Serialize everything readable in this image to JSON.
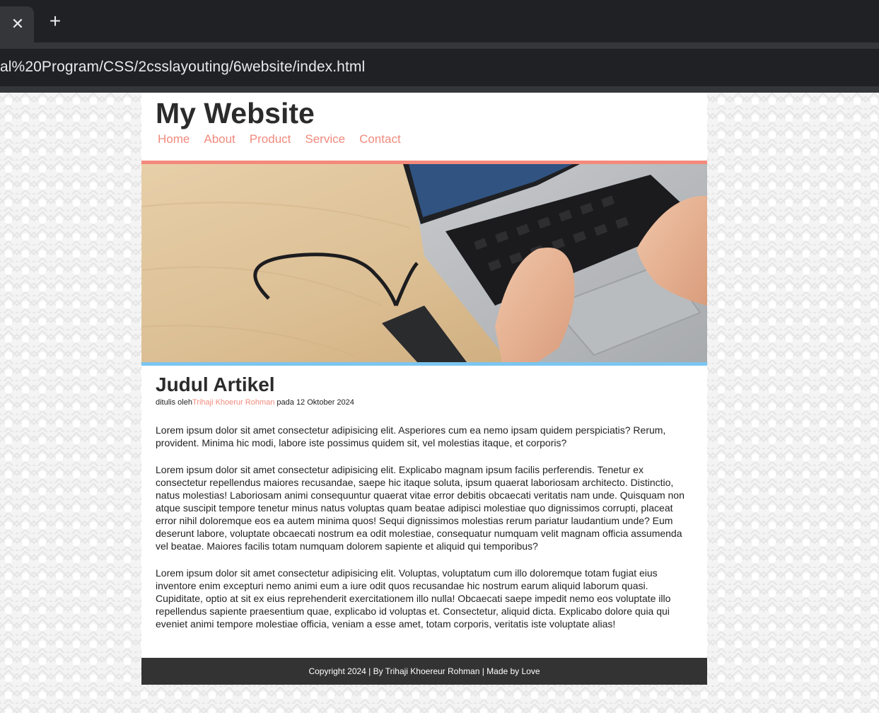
{
  "browser": {
    "close_tab_glyph": "✕",
    "new_tab_glyph": "+",
    "address": "al%20Program/CSS/2csslayouting/6website/index.html"
  },
  "site": {
    "title": "My Website",
    "nav": [
      "Home",
      "About",
      "Product",
      "Service",
      "Contact"
    ]
  },
  "hero": {
    "image": "laptop-and-ssd-photo",
    "accent_top": "#f48a7b",
    "accent_bottom": "#7cc5f0"
  },
  "article": {
    "title": "Judul Artikel",
    "meta_prefix": "ditulis oleh",
    "author": "Trihaji Khoerur Rohman",
    "meta_suffix": " pada 12 Oktober 2024",
    "paragraphs": [
      "Lorem ipsum dolor sit amet consectetur adipisicing elit. Asperiores cum ea nemo ipsam quidem perspiciatis? Rerum, provident. Minima hic modi, labore iste possimus quidem sit, vel molestias itaque, et corporis?",
      "Lorem ipsum dolor sit amet consectetur adipisicing elit. Explicabo magnam ipsum facilis perferendis. Tenetur ex consectetur repellendus maiores recusandae, saepe hic itaque soluta, ipsum quaerat laboriosam architecto. Distinctio, natus molestias! Laboriosam animi consequuntur quaerat vitae error debitis obcaecati veritatis nam unde. Quisquam non atque suscipit tempore tenetur minus natus voluptas quam beatae adipisci molestiae quo dignissimos corrupti, placeat error nihil doloremque eos ea autem minima quos! Sequi dignissimos molestias rerum pariatur laudantium unde? Eum deserunt labore, voluptate obcaecati nostrum ea odit molestiae, consequatur numquam velit magnam officia assumenda vel beatae. Maiores facilis totam numquam dolorem sapiente et aliquid qui temporibus?",
      "Lorem ipsum dolor sit amet consectetur adipisicing elit. Voluptas, voluptatum cum illo doloremque totam fugiat eius inventore enim excepturi nemo animi eum a iure odit quos recusandae hic nostrum earum aliquid laborum quasi. Cupiditate, optio at sit ex eius reprehenderit exercitationem illo nulla! Obcaecati saepe impedit nemo eos voluptate illo repellendus sapiente praesentium quae, explicabo id voluptas et. Consectetur, aliquid dicta. Explicabo dolore quia qui eveniet animi tempore molestiae officia, veniam a esse amet, totam corporis, veritatis iste voluptate alias!"
    ]
  },
  "footer": {
    "text": "Copyright 2024 | By Trihaji Khoereur Rohman | Made by Love"
  },
  "colors": {
    "link": "#f08a7d",
    "footer_bg": "#333333",
    "heading": "#2b2b2b"
  }
}
